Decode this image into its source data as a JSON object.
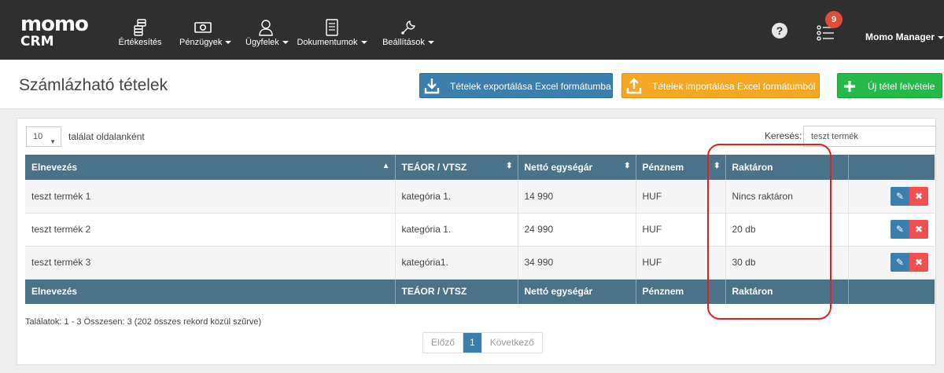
{
  "app": {
    "logo_top": "momo",
    "logo_bottom": "CRM"
  },
  "nav": [
    {
      "label": "Értékesítés",
      "icon": "coins-stack-icon",
      "dropdown": false
    },
    {
      "label": "Pénzügyek",
      "icon": "banknote-icon",
      "dropdown": true
    },
    {
      "label": "Ügyfelek",
      "icon": "person-icon",
      "dropdown": true
    },
    {
      "label": "Dokumentumok",
      "icon": "document-icon",
      "dropdown": true
    },
    {
      "label": "Beállítások",
      "icon": "wrench-icon",
      "dropdown": true
    }
  ],
  "topbar": {
    "help_glyph": "?",
    "notification_count": "9",
    "user_name": "Momo Manager"
  },
  "header": {
    "title": "Számlázható tételek",
    "export_label": "Tételek exportálása Excel formátumba",
    "import_label": "Tételek importálása Excel formátumból",
    "new_label": "Új tétel felvétele"
  },
  "controls": {
    "page_length": "10",
    "page_length_label": "találat oldalanként",
    "search_label": "Keresés:",
    "search_value": "teszt termék"
  },
  "table": {
    "columns": [
      "Elnevezés",
      "TEÁOR / VTSZ",
      "Nettó egységár",
      "Pénznem",
      "Raktáron",
      ""
    ],
    "rows": [
      [
        "teszt termék 1",
        "kategória 1.",
        "14 990",
        "HUF",
        "Nincs raktáron"
      ],
      [
        "teszt termék 2",
        "kategória 1.",
        "24 990",
        "HUF",
        "20 db"
      ],
      [
        "teszt termék 3",
        "kategória1.",
        "34 990",
        "HUF",
        "30 db"
      ]
    ]
  },
  "footer": {
    "info": "Találatok: 1 - 3 Összesen: 3 (202 összes rekord közül szűrve)",
    "prev": "Előző",
    "page": "1",
    "next": "Következő"
  },
  "colors": {
    "navbar": "#2f2f2f",
    "table_header": "#4a7289",
    "export_button": "#3b7fae",
    "import_button": "#f5a623",
    "new_button": "#27b84a",
    "delete_button": "#f05050",
    "highlight": "#e02020",
    "badge": "#e14b3b"
  }
}
